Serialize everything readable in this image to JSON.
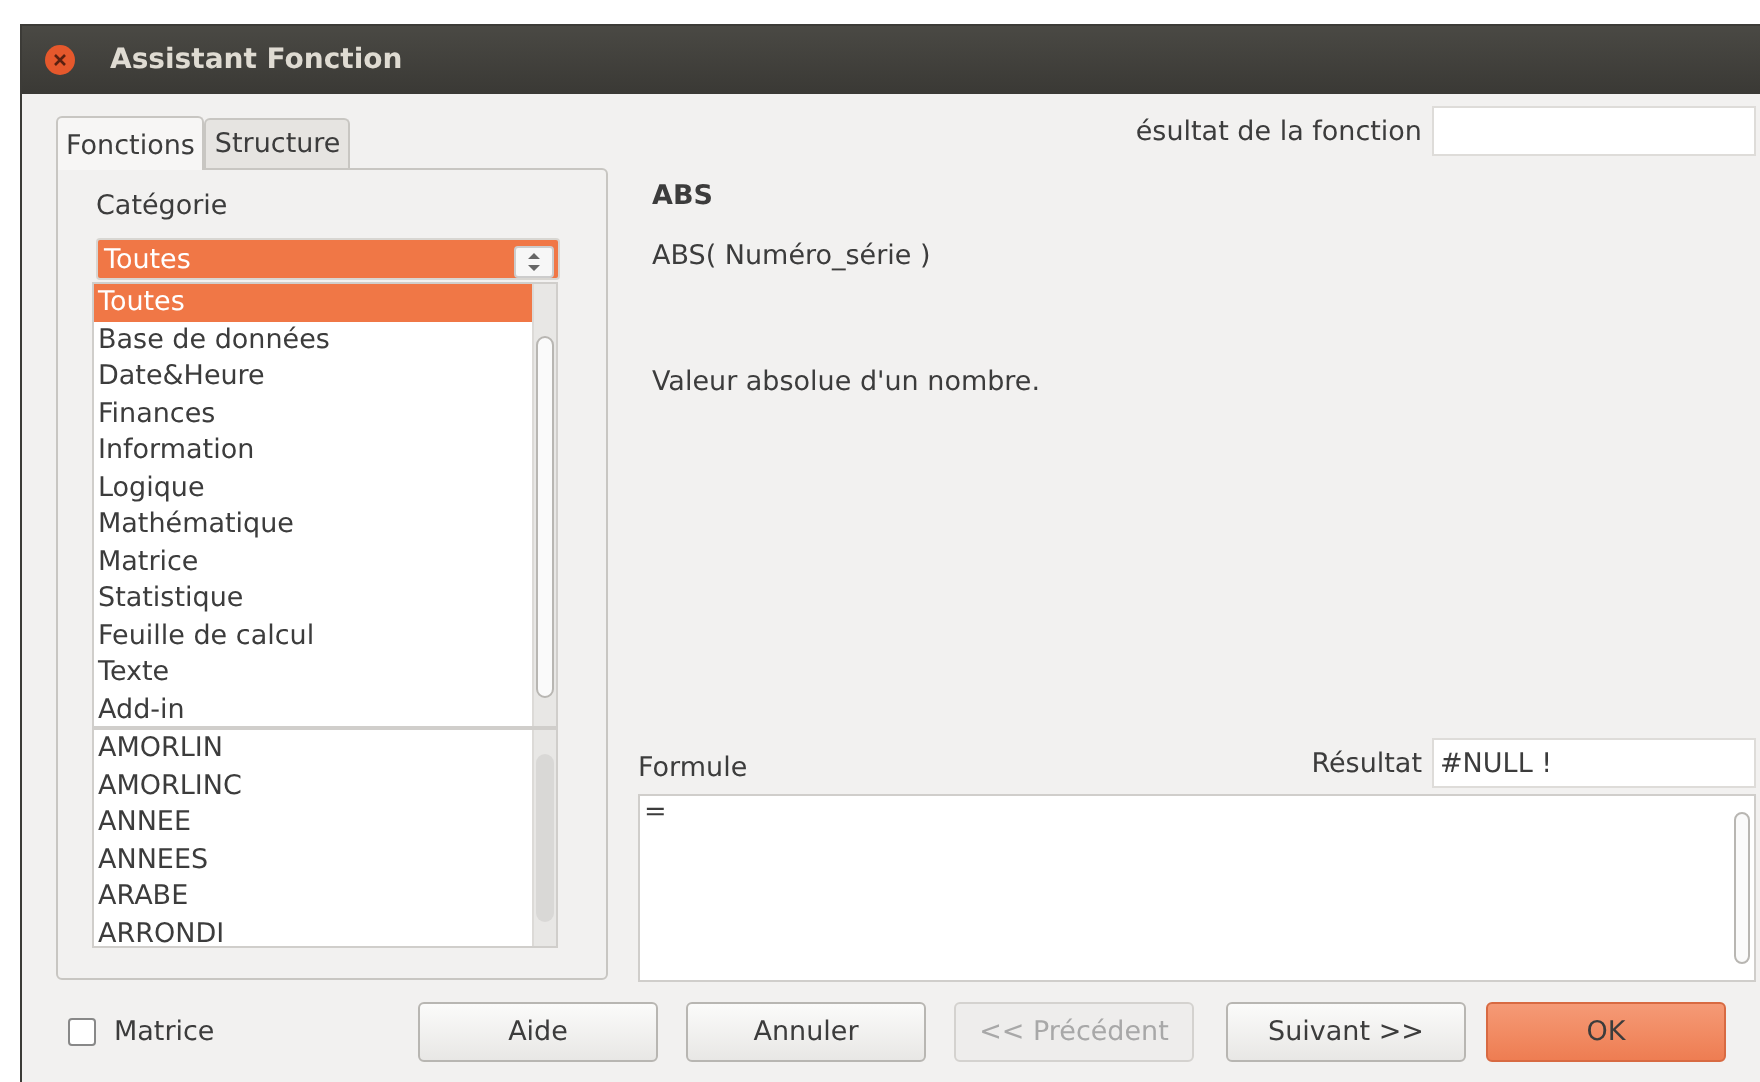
{
  "window": {
    "title": "Assistant Fonction"
  },
  "tabs": [
    {
      "label": "Fonctions",
      "selected": true
    },
    {
      "label": "Structure",
      "selected": false
    }
  ],
  "category": {
    "label": "Catégorie",
    "value": "Toutes",
    "options": [
      {
        "label": "Toutes",
        "selected": true
      },
      {
        "label": "Base de données",
        "selected": false
      },
      {
        "label": "Date&Heure",
        "selected": false
      },
      {
        "label": "Finances",
        "selected": false
      },
      {
        "label": "Information",
        "selected": false
      },
      {
        "label": "Logique",
        "selected": false
      },
      {
        "label": "Mathématique",
        "selected": false
      },
      {
        "label": "Matrice",
        "selected": false
      },
      {
        "label": "Statistique",
        "selected": false
      },
      {
        "label": "Feuille de calcul",
        "selected": false
      },
      {
        "label": "Texte",
        "selected": false
      },
      {
        "label": "Add-in",
        "selected": false
      }
    ]
  },
  "functions": [
    "AMORLIN",
    "AMORLINC",
    "ANNEE",
    "ANNEES",
    "ARABE",
    "ARRONDI"
  ],
  "function_result": {
    "label": "ésultat de la fonction"
  },
  "function_name": "ABS",
  "syntax": "ABS( Numéro_série )",
  "description": "Valeur absolue d'un nombre.",
  "formula": {
    "label": "Formule",
    "value": "="
  },
  "result": {
    "label": "Résultat",
    "value": "#NULL !"
  },
  "matrix": {
    "label": "Matrice",
    "checked": false
  },
  "buttons": [
    {
      "label": "Aide",
      "kind": "normal",
      "disabled": false
    },
    {
      "label": "Annuler",
      "kind": "normal",
      "disabled": false
    },
    {
      "label": "<< Précédent",
      "kind": "normal",
      "disabled": true
    },
    {
      "label": "Suivant >>",
      "kind": "normal",
      "disabled": false
    },
    {
      "label": "OK",
      "kind": "default",
      "disabled": false
    }
  ]
}
